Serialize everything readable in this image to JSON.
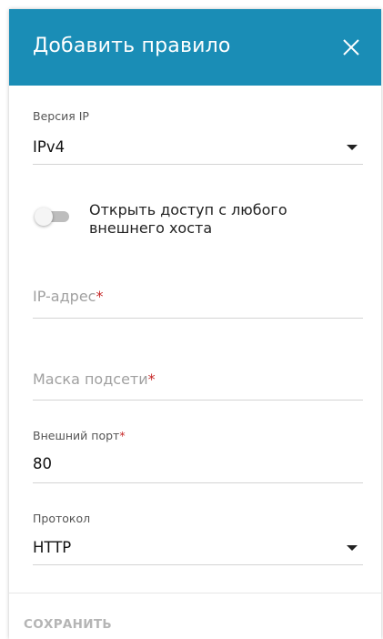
{
  "dialog": {
    "title": "Добавить правило",
    "close_icon": "close-icon",
    "header_color": "#1a8db6"
  },
  "ip_version": {
    "label": "Версия IP",
    "value": "IPv4",
    "icon": "dropdown-arrow-icon"
  },
  "toggle": {
    "label": "Открыть доступ с любого внешнего хоста",
    "checked": false
  },
  "ip_address": {
    "placeholder": "IP-адрес",
    "required_mark": "*"
  },
  "subnet_mask": {
    "placeholder": "Маска подсети",
    "required_mark": "*"
  },
  "external_port": {
    "label": "Внешний порт",
    "required_mark": "*",
    "value": "80"
  },
  "protocol": {
    "label": "Протокол",
    "value": "HTTP",
    "icon": "dropdown-arrow-icon"
  },
  "actions": {
    "save_label": "СОХРАНИТЬ"
  },
  "colors": {
    "accent": "#1a8db6",
    "required": "#c62828",
    "disabled_text": "#b5b5b5"
  }
}
